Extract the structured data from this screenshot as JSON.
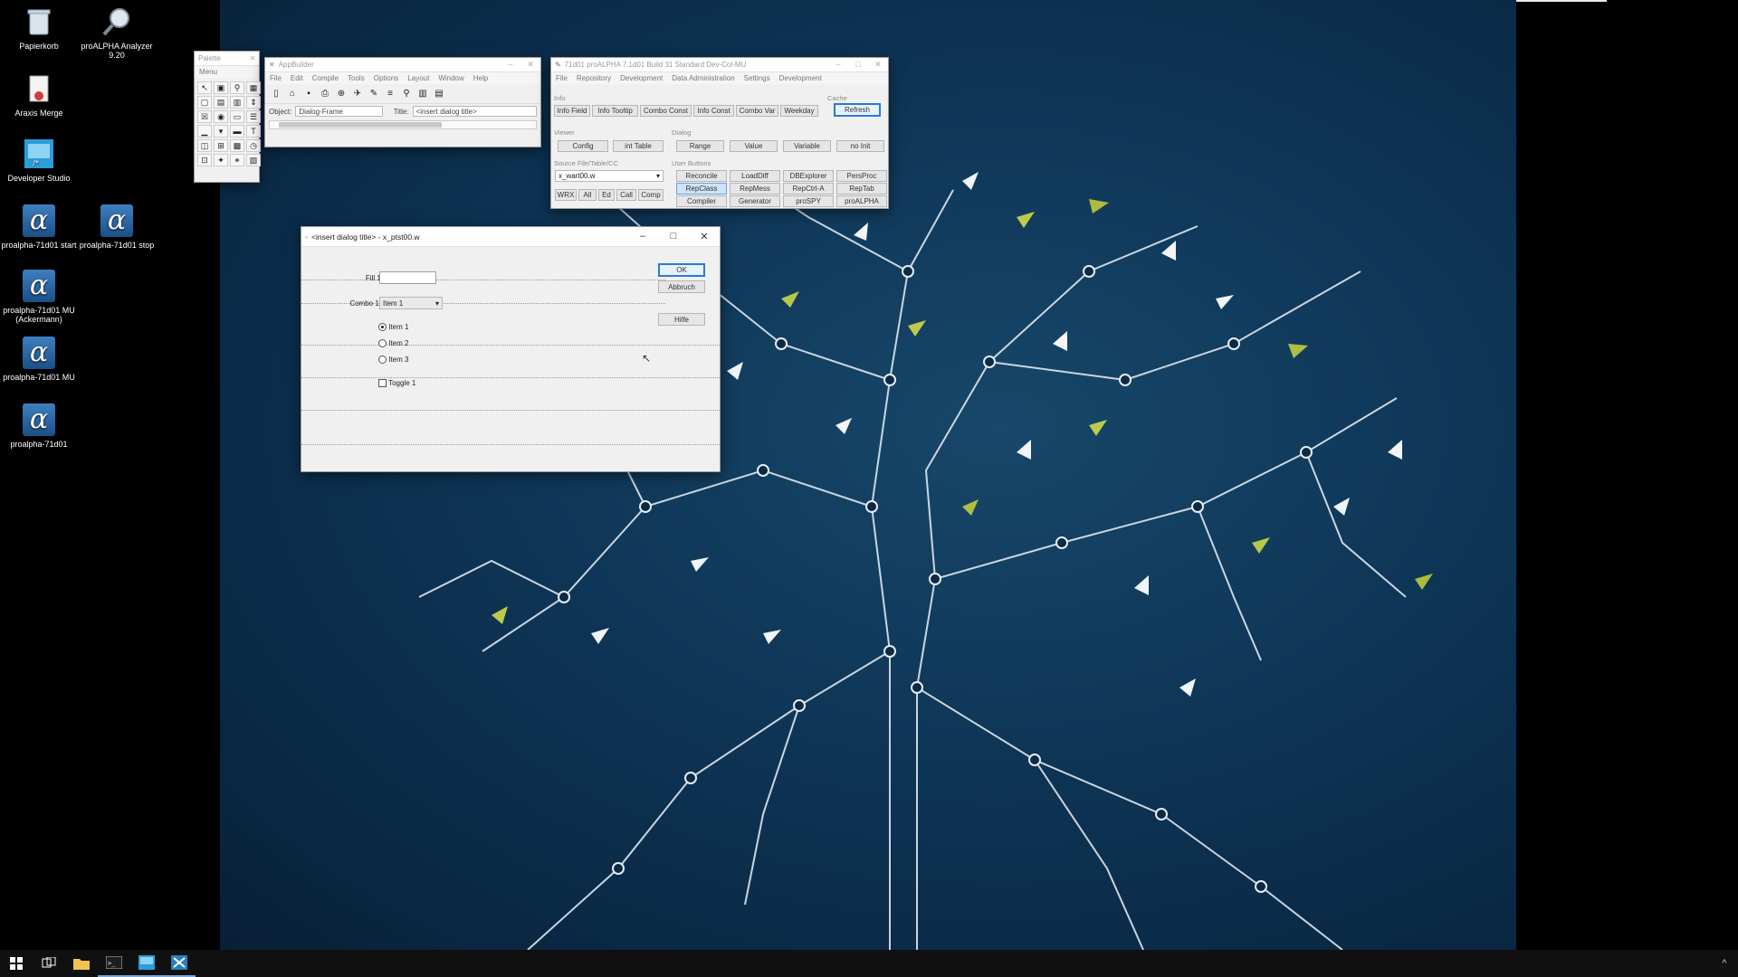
{
  "desktop": {
    "icons": [
      {
        "label": "Papierkorb",
        "icon": "recycle-bin-icon"
      },
      {
        "label": "proALPHA Analyzer 9.20",
        "icon": "analyzer-icon"
      },
      {
        "label": "Araxis Merge",
        "icon": "merge-icon"
      },
      {
        "label": "Developer Studio",
        "icon": "developer-studio-icon"
      },
      {
        "label": "proalpha-71d01 start",
        "icon": "alpha-icon"
      },
      {
        "label": "proalpha-71d01 stop",
        "icon": "alpha-icon"
      },
      {
        "label": "proalpha-71d01 MU (Ackermann)",
        "icon": "alpha-icon"
      },
      {
        "label": "proalpha-71d01 MU",
        "icon": "alpha-icon"
      },
      {
        "label": "proalpha-71d01",
        "icon": "alpha-icon"
      }
    ]
  },
  "palette": {
    "title": "Palette",
    "menu_label": "Menu"
  },
  "appbuilder": {
    "title": "AppBuilder",
    "menu": [
      "File",
      "Edit",
      "Compile",
      "Tools",
      "Options",
      "Layout",
      "Window",
      "Help"
    ],
    "object_label": "Object:",
    "object_value": "Dialog-Frame",
    "title_label": "Title:",
    "title_value": "<insert dialog title>"
  },
  "devtool": {
    "title": "71d01 proALPHA 7.1d01 Build 31 Standard Dev-Col-MU",
    "menu": [
      "File",
      "Repository",
      "Development",
      "Data Administration",
      "Settings",
      "Development"
    ],
    "info_label": "Info",
    "cache_label": "Cache",
    "info_buttons": [
      "Info Field",
      "Info Tooltip",
      "Combo Const",
      "Info Const",
      "Combo Var",
      "Weekday"
    ],
    "refresh_label": "Refresh",
    "viewer_label": "Viewer",
    "dialog_label": "Dialog",
    "viewer_buttons": [
      "Config",
      "int Table"
    ],
    "dialog_buttons": [
      "Range",
      "Value",
      "Variable",
      "no Init"
    ],
    "source_label": "Source File/Table/CC",
    "source_value": "x_wart00.w",
    "source_buttons": [
      "WRX",
      "All",
      "Ed",
      "Call",
      "Comp"
    ],
    "user_buttons_label": "User Buttons",
    "user_buttons": [
      [
        "Reconcile",
        "LoadDiff",
        "DBExplorer",
        "PersProc"
      ],
      [
        "RepClass",
        "RepMess",
        "RepCtrl-A",
        "RepTab"
      ],
      [
        "Compiler",
        "Generator",
        "proSPY",
        "proALPHA"
      ]
    ]
  },
  "dialog": {
    "title": "<insert dialog title> - x_ptst00.w",
    "fill_label": "Fill 1:",
    "fill_value": "",
    "combo_label": "Combo 1:",
    "combo_value": "Item 1",
    "radio_items": [
      "Item 1",
      "Item 2",
      "Item 3"
    ],
    "radio_selected": "Item 1",
    "toggle_label": "Toggle 1",
    "ok_label": "OK",
    "cancel_label": "Abbruch",
    "help_label": "Hilfe"
  },
  "taskbar": {
    "items": [
      "windows-start-icon",
      "task-view-icon",
      "file-explorer-icon",
      "terminal-icon",
      "developer-studio-icon",
      "appbuilder-icon"
    ],
    "tray": "^"
  }
}
